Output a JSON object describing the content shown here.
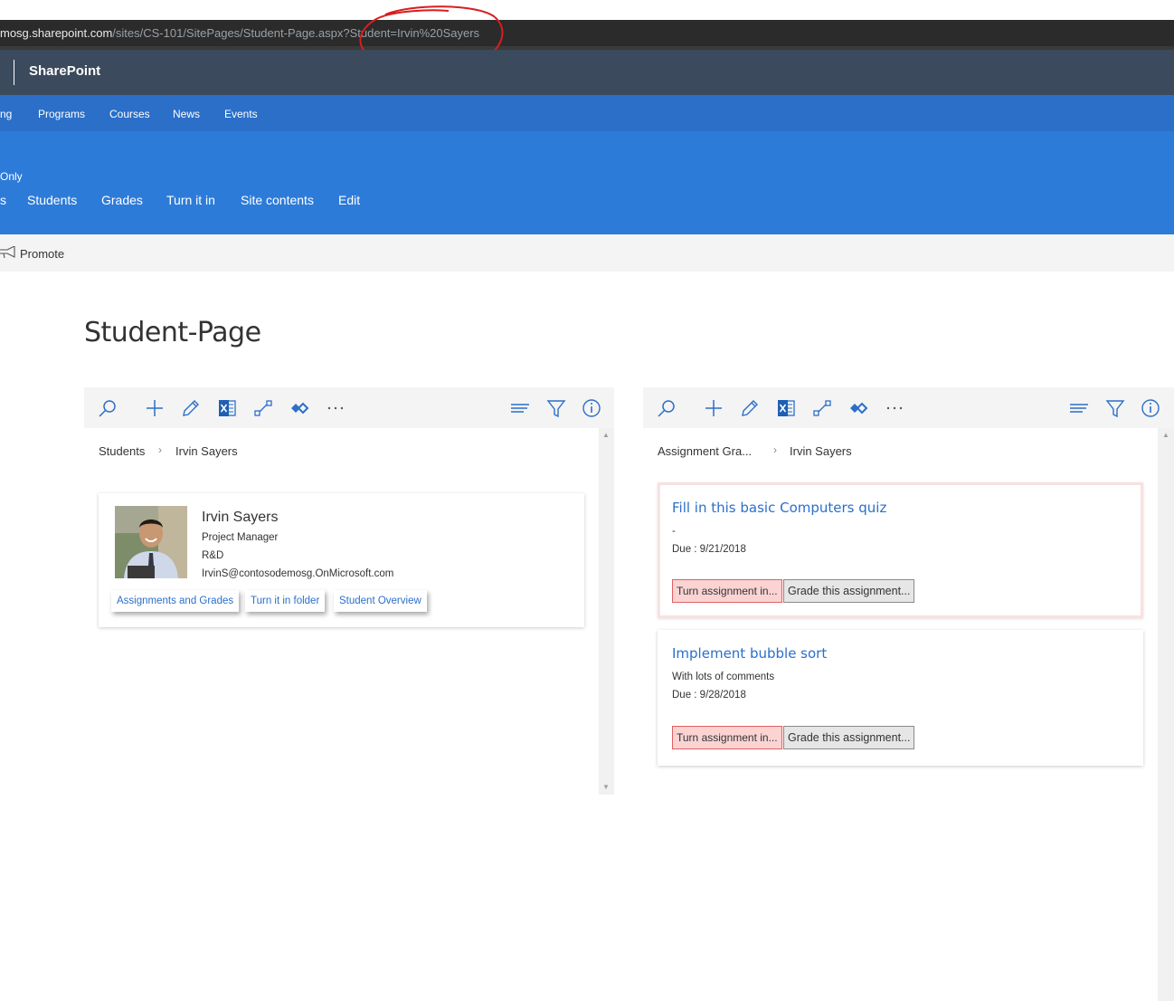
{
  "browser": {
    "url_host": "mosg.sharepoint.com",
    "url_path": "/sites/CS-101/SitePages/Student-Page.aspx?Student=Irvin%20Sayers"
  },
  "suitebar": {
    "brand": "SharePoint"
  },
  "hubnav": {
    "items": [
      "ng",
      "Programs",
      "Courses",
      "News",
      "Events"
    ]
  },
  "site": {
    "only_label": "Only",
    "nav_fragment": "s",
    "nav": [
      "Students",
      "Grades",
      "Turn it in",
      "Site contents",
      "Edit"
    ]
  },
  "commandbar": {
    "promote_label": "Promote",
    "promote_icon": "megaphone-icon"
  },
  "page": {
    "title": "Student-Page"
  },
  "left_panel": {
    "toolbar_icons": [
      "search-icon",
      "add-icon",
      "edit-icon",
      "excel-icon",
      "flow-icon",
      "powerapps-icon",
      "more-icon",
      "view-icon",
      "filter-icon",
      "info-icon"
    ],
    "breadcrumb": [
      "Students",
      "Irvin Sayers"
    ],
    "student": {
      "name": "Irvin Sayers",
      "title": "Project Manager",
      "department": "R&D",
      "email": "IrvinS@contosodemosg.OnMicrosoft.com",
      "links": [
        "Assignments and Grades",
        "Turn it in folder",
        "Student Overview"
      ]
    }
  },
  "right_panel": {
    "breadcrumb": [
      "Assignment Gra...",
      "Irvin Sayers"
    ],
    "assignments": [
      {
        "title": "Fill in this basic Computers quiz",
        "description": "-",
        "due": "Due : 9/21/2018",
        "turn_in_label": "Turn assignment in...",
        "grade_label": "Grade this assignment..."
      },
      {
        "title": "Implement bubble sort",
        "description": "With lots of comments",
        "due": "Due : 9/28/2018",
        "turn_in_label": "Turn assignment in...",
        "grade_label": "Grade this assignment..."
      }
    ]
  },
  "colors": {
    "suitebar": "#3b4a5c",
    "hubnav": "#2b6fc9",
    "site_header": "#2d7bd8",
    "link": "#2b6fc9",
    "turn_in_bg": "#fbd3d3",
    "highlight_annotation": "#d81e1e"
  }
}
